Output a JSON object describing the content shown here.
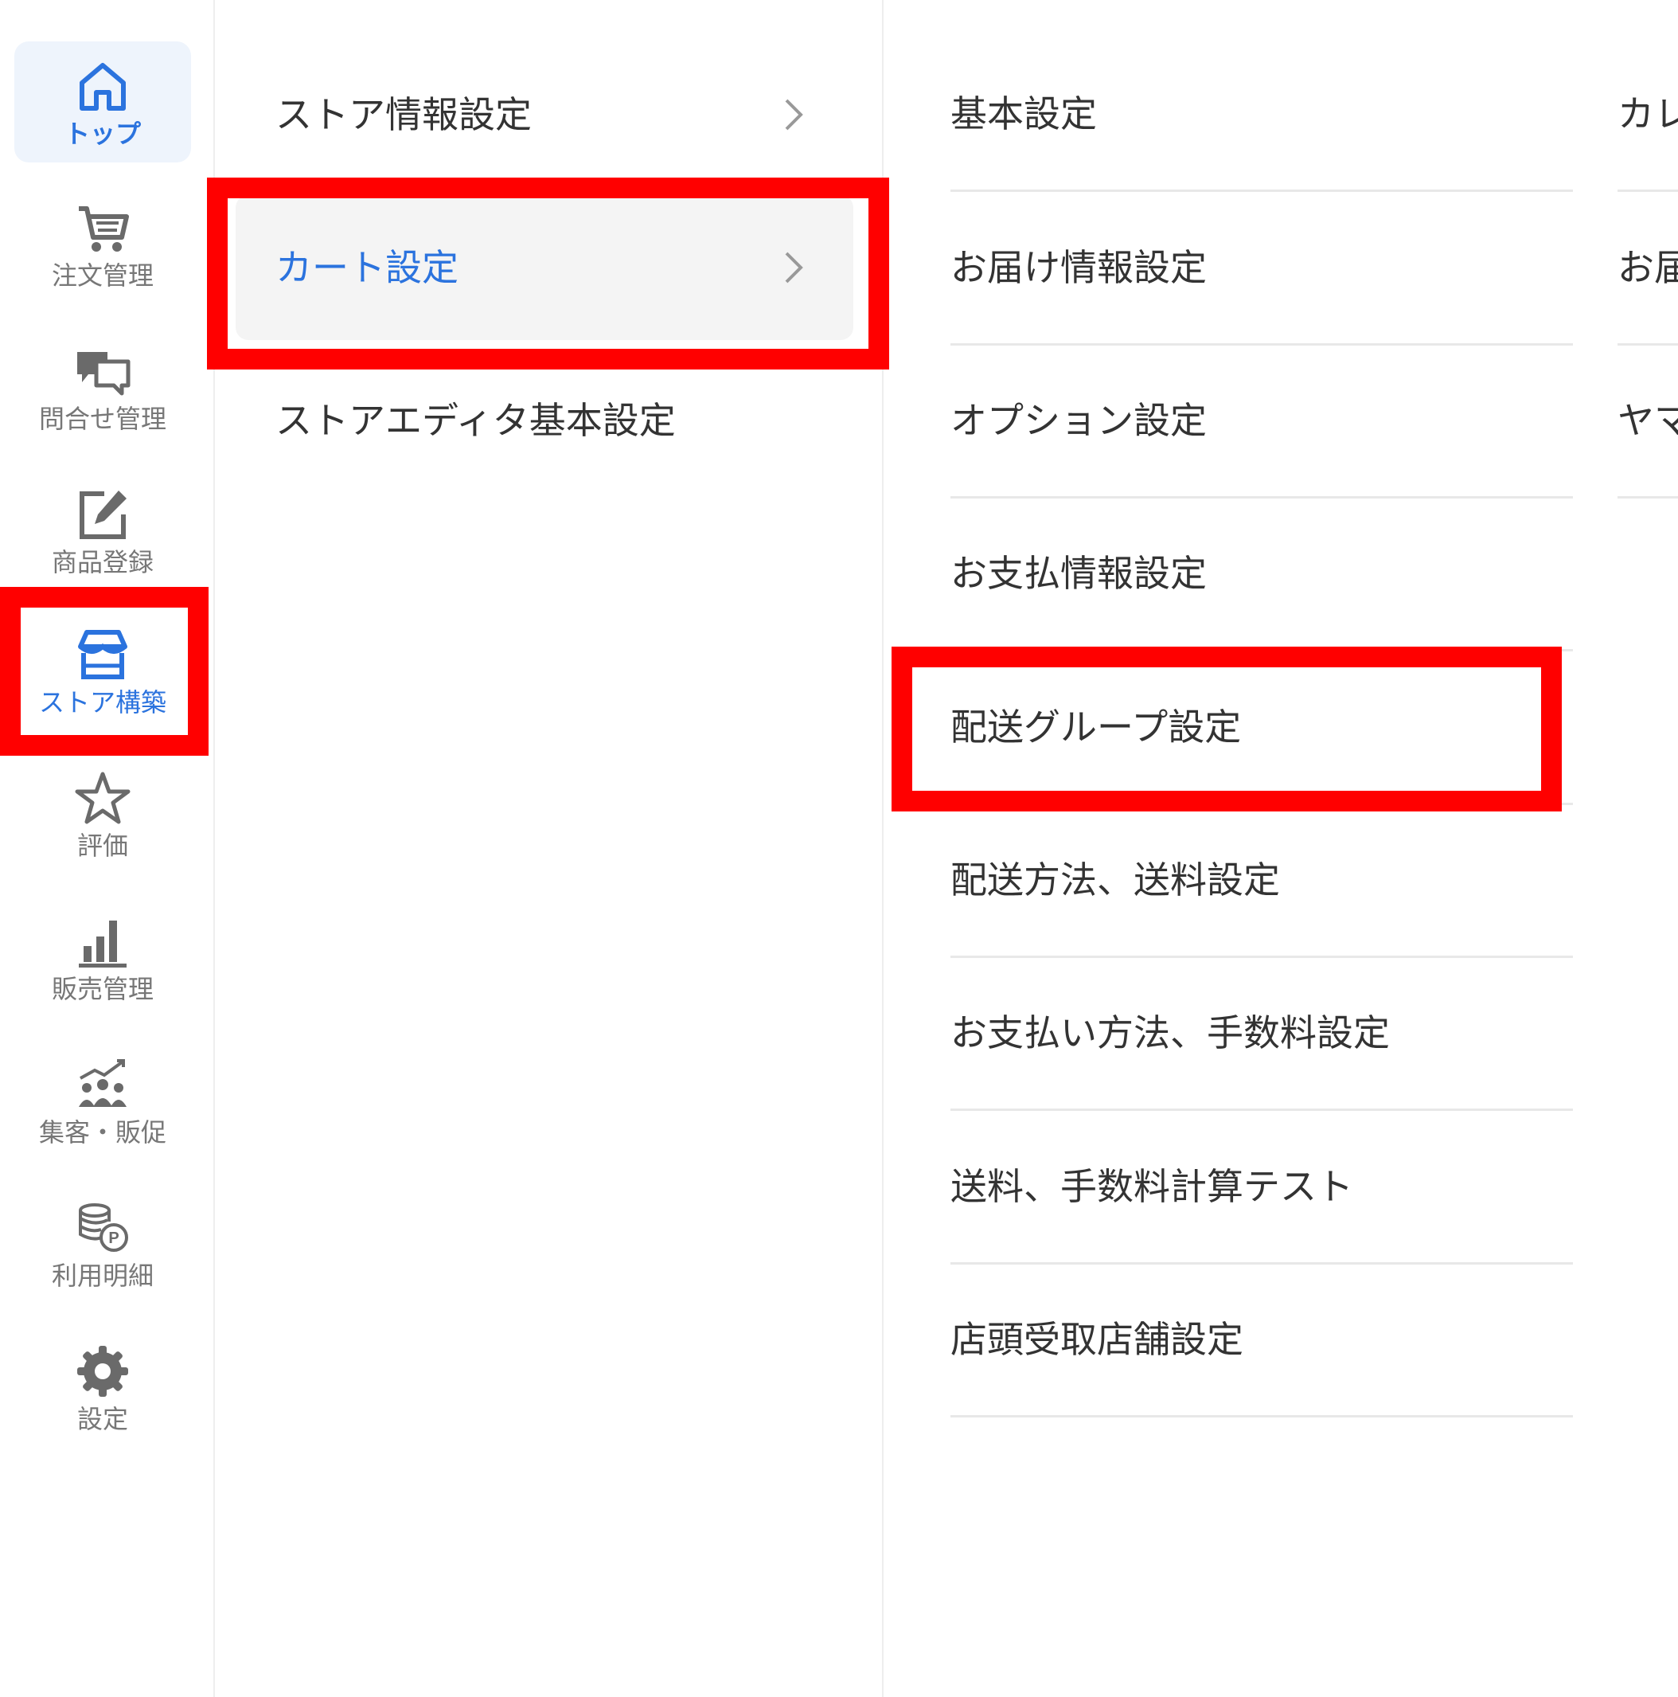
{
  "sidebar": {
    "items": [
      {
        "label": "トップ",
        "icon": "home-icon"
      },
      {
        "label": "注文管理",
        "icon": "cart-icon"
      },
      {
        "label": "問合せ管理",
        "icon": "chat-icon"
      },
      {
        "label": "商品登録",
        "icon": "edit-icon"
      },
      {
        "label": "ストア構築",
        "icon": "store-icon"
      },
      {
        "label": "評価",
        "icon": "star-icon"
      },
      {
        "label": "販売管理",
        "icon": "bar-chart-icon"
      },
      {
        "label": "集客・販促",
        "icon": "people-growth-icon"
      },
      {
        "label": "利用明細",
        "icon": "coins-points-icon"
      },
      {
        "label": "設定",
        "icon": "gear-icon"
      }
    ]
  },
  "submenu": {
    "items": [
      {
        "label": "ストア情報設定"
      },
      {
        "label": "カート設定"
      },
      {
        "label": "ストアエディタ基本設定"
      }
    ]
  },
  "detail": {
    "items": [
      {
        "label": "基本設定"
      },
      {
        "label": "お届け情報設定"
      },
      {
        "label": "オプション設定"
      },
      {
        "label": "お支払情報設定"
      },
      {
        "label": "配送グループ設定"
      },
      {
        "label": "配送方法、送料設定"
      },
      {
        "label": "お支払い方法、手数料設定"
      },
      {
        "label": "送料、手数料計算テスト"
      },
      {
        "label": "店頭受取店舗設定"
      }
    ]
  },
  "column4": {
    "items": [
      {
        "label": "カレ"
      },
      {
        "label": "お届"
      },
      {
        "label": "ヤマ"
      }
    ]
  },
  "colors": {
    "accent": "#2b73de",
    "highlight": "#ff0000",
    "active_bg": "#eef4fc",
    "selected_bg": "#f4f4f4"
  }
}
